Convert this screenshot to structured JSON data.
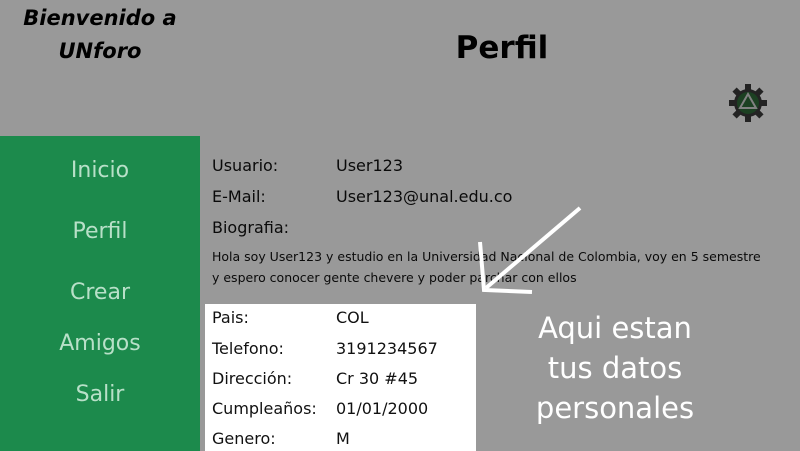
{
  "header": {
    "welcome_line1": "Bienvenido a",
    "welcome_line2": "UNforo",
    "page_title": "Perfil",
    "settings_icon": "gear-icon"
  },
  "sidebar": {
    "items": [
      {
        "label": "Inicio"
      },
      {
        "label": "Perfil"
      },
      {
        "label": "Crear"
      },
      {
        "label": "Amigos"
      },
      {
        "label": "Salir"
      }
    ]
  },
  "profile": {
    "usuario_label": "Usuario:",
    "usuario_value": "User123",
    "email_label": "E-Mail:",
    "email_value": "User123@unal.edu.co",
    "bio_label": "Biografia:",
    "bio_text": "Hola soy User123 y estudio en la Universidad Nacional de Colombia, voy en 5 semestre y espero conocer gente chevere y poder parchar con ellos",
    "personal": [
      {
        "label": "Pais:",
        "value": "COL"
      },
      {
        "label": "Telefono:",
        "value": "3191234567"
      },
      {
        "label": "Dirección:",
        "value": "Cr 30 #45"
      },
      {
        "label": "Cumpleaños:",
        "value": "01/01/2000"
      },
      {
        "label": "Genero:",
        "value": "M"
      }
    ]
  },
  "tutorial": {
    "callout_line1": "Aqui estan",
    "callout_line2": "tus datos",
    "callout_line3": "personales"
  },
  "colors": {
    "sidebar_bg": "#1c8a4c",
    "nav_text": "#b8e0c8",
    "gear": "#2f6b3a",
    "overlay": "rgba(0,0,0,0.40)"
  }
}
